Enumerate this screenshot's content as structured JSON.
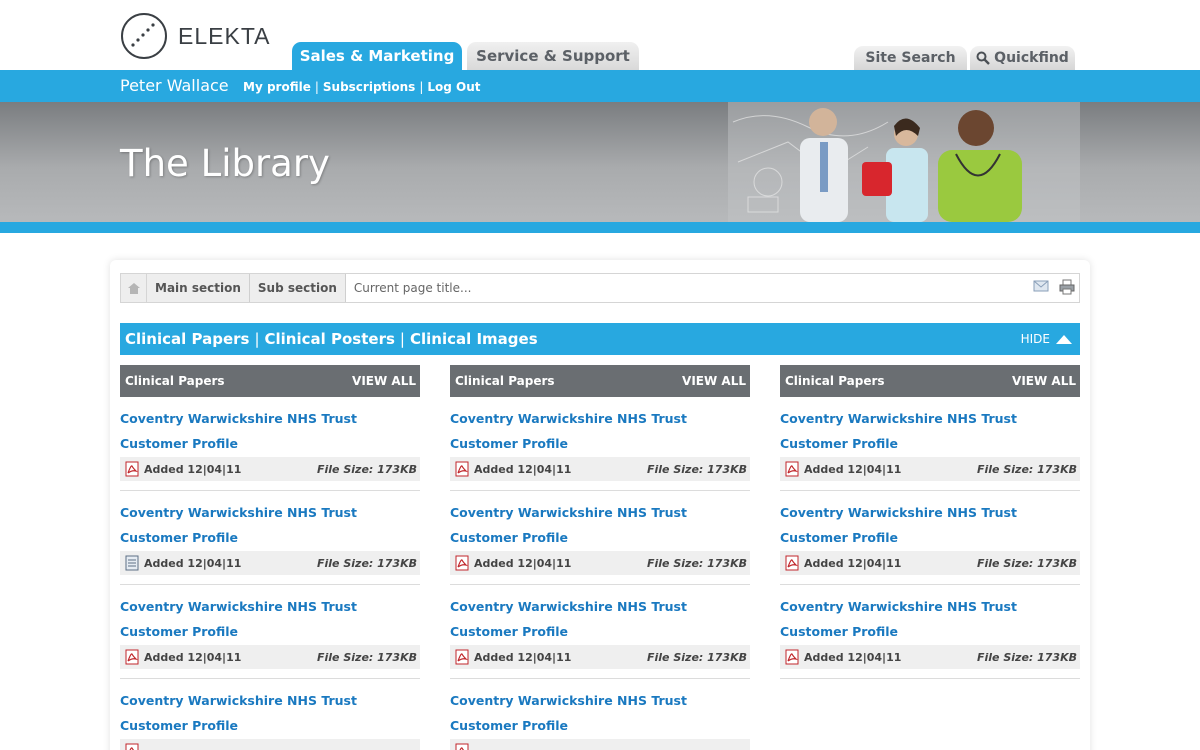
{
  "brand": {
    "name": "ELEKTA"
  },
  "nav": {
    "tabs": [
      {
        "label": "Sales & Marketing",
        "active": true
      },
      {
        "label": "Service & Support",
        "active": false
      }
    ],
    "site_search": "Site Search",
    "quickfind": "Quickfind"
  },
  "user": {
    "name": "Peter Wallace",
    "links": [
      "My profile",
      "Subscriptions",
      "Log Out"
    ]
  },
  "banner": {
    "title": "The Library"
  },
  "breadcrumb": {
    "items": [
      "Main section",
      "Sub section"
    ],
    "current": "Current page title..."
  },
  "section": {
    "tabs": [
      "Clinical Papers",
      "Clinical Posters",
      "Clinical Images"
    ],
    "hide_label": "HIDE"
  },
  "colors": {
    "accent": "#28a8e0",
    "link": "#1a79c0",
    "column_header": "#6a6e72"
  },
  "columns": [
    {
      "title": "Clinical Papers",
      "view_all": "VIEW ALL",
      "items": [
        {
          "title": "Coventry Warwickshire NHS Trust Customer Profile",
          "icon": "pdf-icon",
          "added": "Added 12|04|11",
          "size": "File Size: 173KB"
        },
        {
          "title": "Coventry Warwickshire NHS Trust Customer Profile",
          "icon": "document-icon",
          "added": "Added 12|04|11",
          "size": "File Size: 173KB"
        },
        {
          "title": "Coventry Warwickshire NHS Trust Customer Profile",
          "icon": "pdf-icon",
          "added": "Added 12|04|11",
          "size": "File Size: 173KB"
        },
        {
          "title": "Coventry Warwickshire NHS Trust Customer Profile",
          "icon": "pdf-icon",
          "added": "",
          "size": ""
        }
      ]
    },
    {
      "title": "Clinical Papers",
      "view_all": "VIEW ALL",
      "items": [
        {
          "title": "Coventry Warwickshire NHS Trust Customer Profile",
          "icon": "pdf-icon",
          "added": "Added 12|04|11",
          "size": "File Size: 173KB"
        },
        {
          "title": "Coventry Warwickshire NHS Trust Customer Profile",
          "icon": "pdf-icon",
          "added": "Added 12|04|11",
          "size": "File Size: 173KB"
        },
        {
          "title": "Coventry Warwickshire NHS Trust Customer Profile",
          "icon": "pdf-icon",
          "added": "Added 12|04|11",
          "size": "File Size: 173KB"
        },
        {
          "title": "Coventry Warwickshire NHS Trust Customer Profile",
          "icon": "pdf-icon",
          "added": "",
          "size": ""
        }
      ]
    },
    {
      "title": "Clinical Papers",
      "view_all": "VIEW ALL",
      "items": [
        {
          "title": "Coventry Warwickshire NHS Trust Customer Profile",
          "icon": "pdf-icon",
          "added": "Added 12|04|11",
          "size": "File Size: 173KB"
        },
        {
          "title": "Coventry Warwickshire NHS Trust Customer Profile",
          "icon": "pdf-icon",
          "added": "Added 12|04|11",
          "size": "File Size: 173KB"
        },
        {
          "title": "Coventry Warwickshire NHS Trust Customer Profile",
          "icon": "pdf-icon",
          "added": "Added 12|04|11",
          "size": "File Size: 173KB"
        }
      ]
    }
  ]
}
